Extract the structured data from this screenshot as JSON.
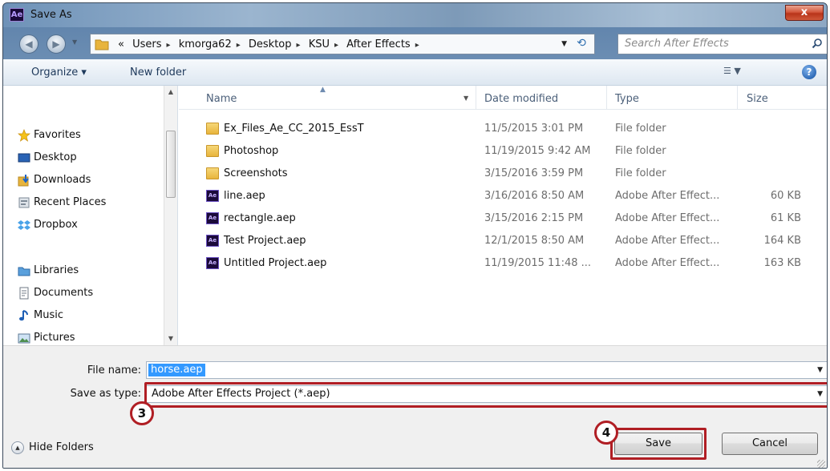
{
  "window": {
    "title": "Save As",
    "app_icon_text": "Ae",
    "close_glyph": "x"
  },
  "address": {
    "crumbs": [
      "«",
      "Users",
      "kmorga62",
      "Desktop",
      "KSU",
      "After Effects"
    ],
    "separator": "▸",
    "search_placeholder": "Search After Effects"
  },
  "toolbar": {
    "organize_label": "Organize ▾",
    "new_folder_label": "New folder",
    "help_glyph": "?"
  },
  "navigation": {
    "favorites_label": "Favorites",
    "favorites": [
      "Desktop",
      "Downloads",
      "Recent Places",
      "Dropbox"
    ],
    "libraries_label": "Libraries",
    "libraries": [
      "Documents",
      "Music",
      "Pictures"
    ]
  },
  "columns": {
    "name": "Name",
    "date": "Date modified",
    "type": "Type",
    "size": "Size"
  },
  "files": [
    {
      "name": "Ex_Files_Ae_CC_2015_EssT",
      "date": "11/5/2015 3:01 PM",
      "type": "File folder",
      "size": "",
      "icon": "folder-icon"
    },
    {
      "name": "Photoshop",
      "date": "11/19/2015 9:42 AM",
      "type": "File folder",
      "size": "",
      "icon": "folder-icon"
    },
    {
      "name": "Screenshots",
      "date": "3/15/2016 3:59 PM",
      "type": "File folder",
      "size": "",
      "icon": "folder-icon"
    },
    {
      "name": "line.aep",
      "date": "3/16/2016 8:50 AM",
      "type": "Adobe After Effect...",
      "size": "60 KB",
      "icon": "after-effects-file-icon"
    },
    {
      "name": "rectangle.aep",
      "date": "3/15/2016 2:15 PM",
      "type": "Adobe After Effect...",
      "size": "61 KB",
      "icon": "after-effects-file-icon"
    },
    {
      "name": "Test Project.aep",
      "date": "12/1/2015 8:50 AM",
      "type": "Adobe After Effect...",
      "size": "164 KB",
      "icon": "after-effects-file-icon"
    },
    {
      "name": "Untitled Project.aep",
      "date": "11/19/2015 11:48 ...",
      "type": "Adobe After Effect...",
      "size": "163 KB",
      "icon": "after-effects-file-icon"
    }
  ],
  "form": {
    "file_name_label": "File name:",
    "file_name_value": "horse.aep",
    "save_type_label": "Save as type:",
    "save_type_value": "Adobe After Effects Project (*.aep)"
  },
  "buttons": {
    "hide_folders": "Hide Folders",
    "save": "Save",
    "cancel": "Cancel"
  },
  "callouts": {
    "step3": "3",
    "step4": "4"
  },
  "colors": {
    "callout_red": "#b01e24",
    "selection_blue": "#3399ff"
  }
}
